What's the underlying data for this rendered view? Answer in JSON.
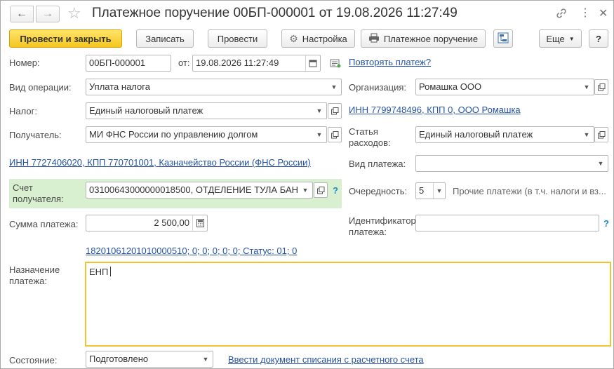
{
  "window": {
    "title": "Платежное поручение 00БП-000001 от 19.08.2026 11:27:49"
  },
  "toolbar": {
    "post_and_close": "Провести и закрыть",
    "save": "Записать",
    "post": "Провести",
    "settings": "Настройка",
    "payment_order": "Платежное поручение",
    "more": "Еще",
    "help": "?"
  },
  "form": {
    "number_label": "Номер:",
    "number_value": "00БП-000001",
    "date_label": "от:",
    "date_value": "19.08.2026 11:27:49",
    "repeat_link": "Повторять платеж?",
    "operation_label": "Вид операции:",
    "operation_value": "Уплата налога",
    "org_label": "Организация:",
    "org_value": "Ромашка ООО",
    "tax_label": "Налог:",
    "tax_value": "Единый налоговый платеж",
    "org_inn_link": "ИНН 7799748496, КПП 0, ООО Ромашка",
    "recipient_label": "Получатель:",
    "recipient_value": "МИ ФНС России по управлению долгом",
    "expense_label": "Статья расходов:",
    "expense_value": "Единый налоговый платеж",
    "recipient_inn_link": "ИНН 7727406020, КПП 770701001, Казначейство России (ФНС России)",
    "payment_type_label": "Вид платежа:",
    "payment_type_value": "",
    "account_label": "Счет получателя:",
    "account_value": "03100643000000018500, ОТДЕЛЕНИЕ ТУЛА БАН",
    "account_help": "?",
    "priority_label": "Очередность:",
    "priority_value": "5",
    "priority_desc": "Прочие платежи (в т.ч. налоги и вз...",
    "amount_label": "Сумма платежа:",
    "amount_value": "2 500,00",
    "identifier_label": "Идентификатор платежа:",
    "identifier_value": "",
    "identifier_help": "?",
    "kbk_link": "18201061201010000510; 0; 0; 0; 0; 0; Статус: 01; 0",
    "purpose_label": "Назначение платежа:",
    "purpose_value": "ЕНП",
    "state_label": "Состояние:",
    "state_value": "Подготовлено",
    "writeoff_link": "Ввести документ списания с расчетного счета"
  },
  "colors": {
    "primary_button": "#f5c61e",
    "link": "#2653a4",
    "highlight_green": "#d8efd0",
    "active_border": "#f1c232"
  }
}
